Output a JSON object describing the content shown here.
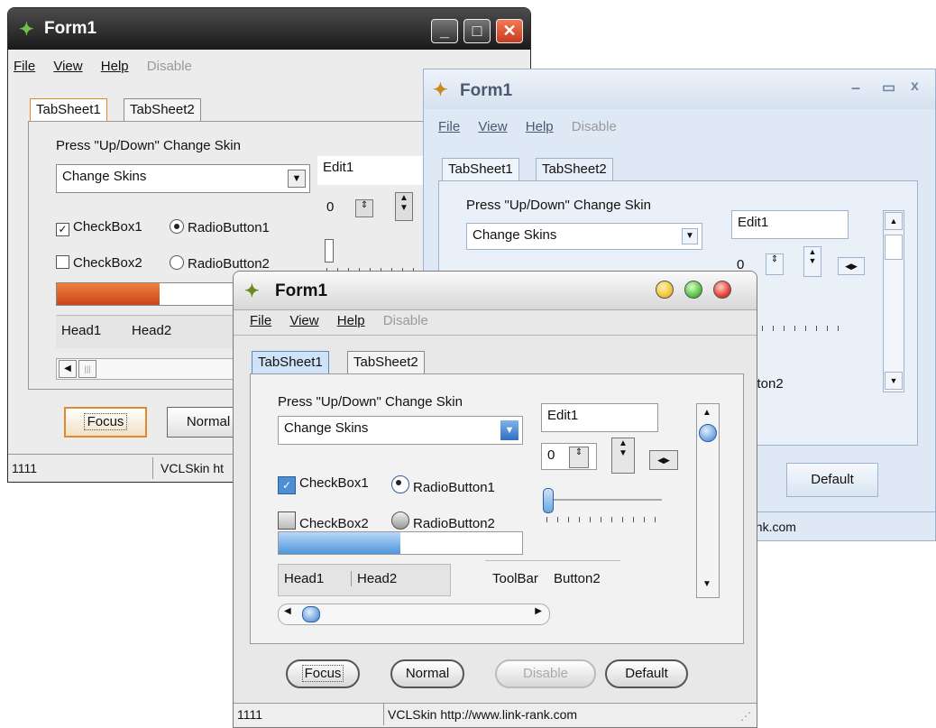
{
  "windows": [
    {
      "title": "Form1",
      "menu": {
        "file": "File",
        "view": "View",
        "help": "Help",
        "disable": "Disable"
      },
      "tabs": [
        "TabSheet1",
        "TabSheet2"
      ],
      "skin_label": "Press \"Up/Down\" Change Skin",
      "combo_value": "Change Skins",
      "edit_value": "Edit1",
      "spin_value": "0",
      "checkbox1": "CheckBox1",
      "checkbox2": "CheckBox2",
      "radio1": "RadioButton1",
      "radio2": "RadioButton2",
      "header1": "Head1",
      "header2": "Head2",
      "progress": 0.38,
      "focus_button": "Focus",
      "normal_button": "Normal",
      "status_left": "1111",
      "status_right": "VCLSkin ht"
    },
    {
      "title": "Form1",
      "menu": {
        "file": "File",
        "view": "View",
        "help": "Help",
        "disable": "Disable"
      },
      "tabs": [
        "TabSheet1",
        "TabSheet2"
      ],
      "skin_label": "Press \"Up/Down\" Change Skin",
      "combo_value": "Change Skins",
      "edit_value": "Edit1",
      "spin_value": "0",
      "toolbar_partial": "utton2",
      "default_button": "Default",
      "status_right": "ank.com"
    },
    {
      "title": "Form1",
      "menu": {
        "file": "File",
        "view": "View",
        "help": "Help",
        "disable": "Disable"
      },
      "tabs": [
        "TabSheet1",
        "TabSheet2"
      ],
      "skin_label": "Press \"Up/Down\" Change Skin",
      "combo_value": "Change Skins",
      "edit_value": "Edit1",
      "spin_value": "0",
      "checkbox1": "CheckBox1",
      "checkbox2": "CheckBox2",
      "radio1": "RadioButton1",
      "radio2": "RadioButton2",
      "header1": "Head1",
      "header2": "Head2",
      "toolbar_label": "ToolBar",
      "toolbar_button2": "Button2",
      "progress": 0.5,
      "focus_button": "Focus",
      "normal_button": "Normal",
      "disable_button": "Disable",
      "default_button": "Default",
      "status_left": "1111",
      "status_right": "VCLSkin http://www.link-rank.com"
    }
  ],
  "colors": {
    "dark_title": "#2a2a2a",
    "progress_orange": "#d9561c",
    "progress_blue": "#4f95db",
    "orb_yellow": "#f2c53a",
    "orb_green": "#5cc24a",
    "orb_red": "#e0463a",
    "close_red": "#e4532f"
  },
  "icons": [
    "app-icon",
    "minimize-icon",
    "maximize-icon",
    "close-icon",
    "dropdown-arrow-icon",
    "spin-up-icon",
    "spin-down-icon",
    "scroll-left-icon",
    "scroll-right-icon",
    "scroll-up-icon",
    "scroll-down-icon",
    "size-grip-icon"
  ]
}
